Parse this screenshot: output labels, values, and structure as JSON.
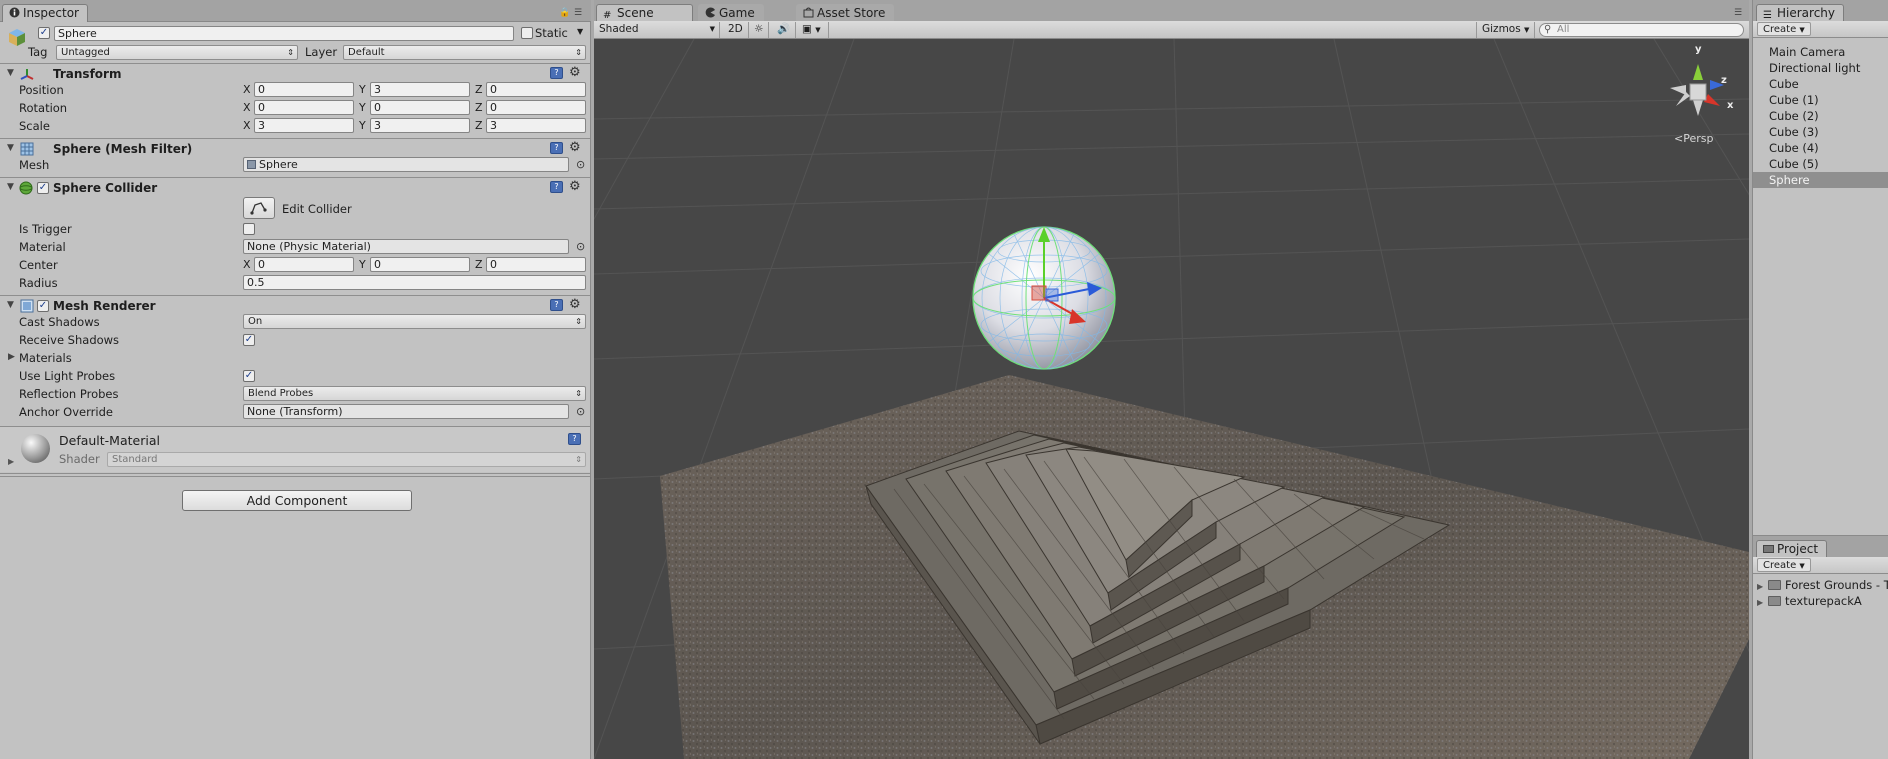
{
  "inspector": {
    "tab": "Inspector",
    "object": {
      "name": "Sphere",
      "static_label": "Static",
      "tag_label": "Tag",
      "tag_value": "Untagged",
      "layer_label": "Layer",
      "layer_value": "Default"
    },
    "transform": {
      "title": "Transform",
      "position_label": "Position",
      "position": {
        "x": "0",
        "y": "3",
        "z": "0"
      },
      "rotation_label": "Rotation",
      "rotation": {
        "x": "0",
        "y": "0",
        "z": "0"
      },
      "scale_label": "Scale",
      "scale": {
        "x": "3",
        "y": "3",
        "z": "3"
      }
    },
    "axes": {
      "x": "X",
      "y": "Y",
      "z": "Z"
    },
    "mesh_filter": {
      "title": "Sphere (Mesh Filter)",
      "mesh_label": "Mesh",
      "mesh_value": "Sphere"
    },
    "sphere_collider": {
      "title": "Sphere Collider",
      "edit_label": "Edit Collider",
      "is_trigger_label": "Is Trigger",
      "material_label": "Material",
      "material_value": "None (Physic Material)",
      "center_label": "Center",
      "center": {
        "x": "0",
        "y": "0",
        "z": "0"
      },
      "radius_label": "Radius",
      "radius_value": "0.5"
    },
    "mesh_renderer": {
      "title": "Mesh Renderer",
      "cast_shadows_label": "Cast Shadows",
      "cast_shadows_value": "On",
      "receive_shadows_label": "Receive Shadows",
      "materials_label": "Materials",
      "light_probes_label": "Use Light Probes",
      "reflection_probes_label": "Reflection Probes",
      "reflection_probes_value": "Blend Probes",
      "anchor_label": "Anchor Override",
      "anchor_value": "None (Transform)"
    },
    "material": {
      "name": "Default-Material",
      "shader_label": "Shader",
      "shader_value": "Standard"
    },
    "add_component": "Add Component"
  },
  "scene": {
    "tabs": [
      "Scene",
      "Game",
      "Asset Store"
    ],
    "toolbar": {
      "shading": "Shaded",
      "mode_2d": "2D",
      "gizmos": "Gizmos",
      "search_placeholder": "All"
    },
    "gizmo_persp": "Persp",
    "gizmo_axes": {
      "x": "x",
      "y": "y",
      "z": "z"
    }
  },
  "hierarchy": {
    "tab": "Hierarchy",
    "create": "Create",
    "items": [
      "Main Camera",
      "Directional light",
      "Cube",
      "Cube (1)",
      "Cube (2)",
      "Cube (3)",
      "Cube (4)",
      "Cube (5)",
      "Sphere"
    ],
    "selected": "Sphere"
  },
  "project": {
    "tab": "Project",
    "create": "Create",
    "folders": [
      "Forest Grounds - T",
      "texturepackA"
    ]
  },
  "colors": {
    "selection": "#8f8f8f",
    "panel": "#c2c2c2",
    "viewport": "#474747",
    "accent_blue": "#4a6fb5"
  }
}
